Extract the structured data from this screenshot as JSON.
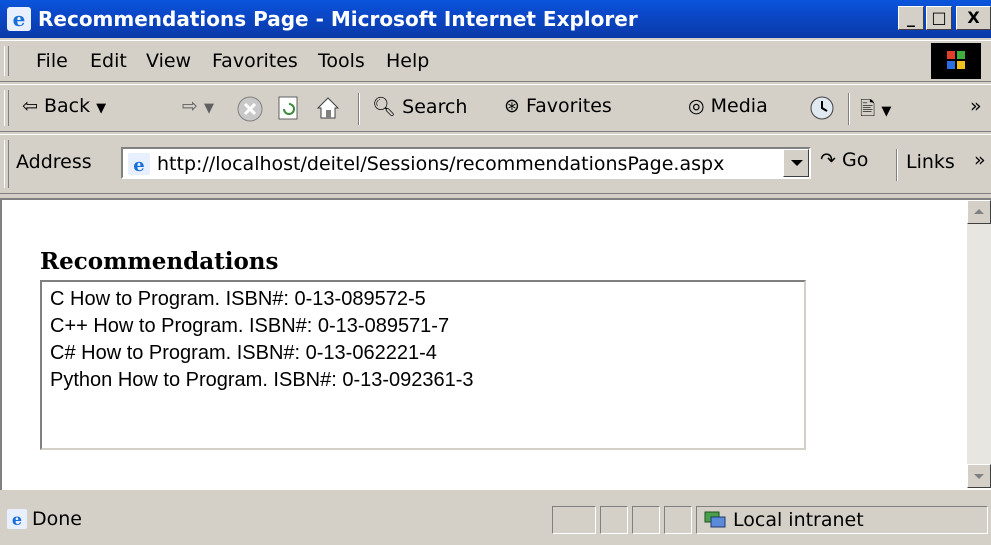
{
  "window": {
    "title": "Recommendations Page - Microsoft Internet Explorer",
    "min_label": "_",
    "max_label": "□",
    "close_label": "X"
  },
  "menubar": {
    "items": [
      {
        "label": "File"
      },
      {
        "label": "Edit"
      },
      {
        "label": "View"
      },
      {
        "label": "Favorites"
      },
      {
        "label": "Tools"
      },
      {
        "label": "Help"
      }
    ]
  },
  "toolbar": {
    "back_label": "Back",
    "search_label": "Search",
    "favorites_label": "Favorites",
    "media_label": "Media",
    "chevron": "»"
  },
  "address": {
    "label": "Address",
    "url": "http://localhost/deitel/Sessions/recommendationsPage.aspx",
    "go_label": "Go",
    "links_label": "Links",
    "links_chevron": "»"
  },
  "content": {
    "heading": "Recommendations",
    "books": [
      "C How to Program. ISBN#: 0-13-089572-5",
      "C++ How to Program. ISBN#: 0-13-089571-7",
      "C# How to Program. ISBN#: 0-13-062221-4",
      "Python How to Program. ISBN#: 0-13-092361-3"
    ]
  },
  "status": {
    "text": "Done",
    "zone": "Local intranet"
  },
  "colors": {
    "title_bar": "#0a55dc",
    "chrome": "#d4d0c8",
    "page_background": "#ffffff"
  }
}
